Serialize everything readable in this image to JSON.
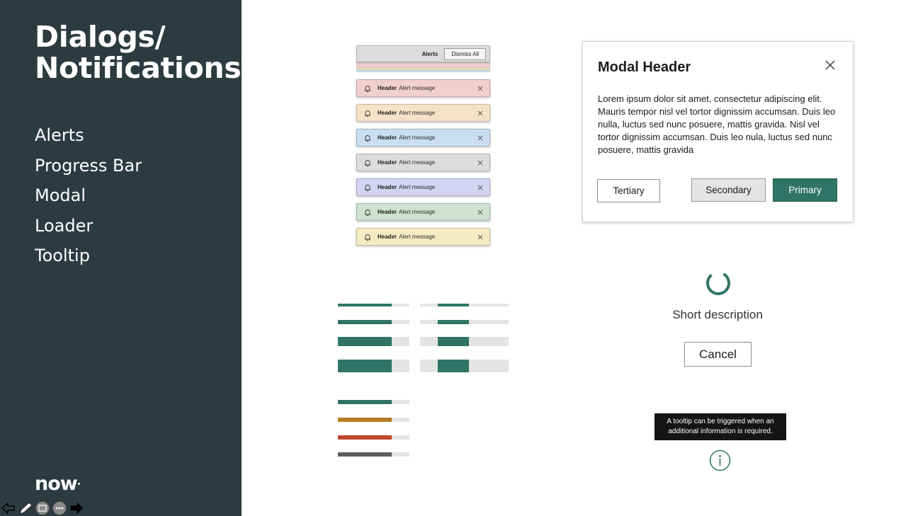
{
  "sidebar": {
    "title": "Dialogs/\nNotifications",
    "nav": [
      "Alerts",
      "Progress Bar",
      "Modal",
      "Loader",
      "Tooltip"
    ],
    "logo": "now"
  },
  "alerts": {
    "bar_label": "Alerts",
    "dismiss_label": "Dismiss All",
    "items": [
      {
        "header": "Header",
        "message": "Alert message",
        "color": "#efd0cd",
        "icon": "bell-icon"
      },
      {
        "header": "Header",
        "message": "Alert message",
        "color": "#f6e2c9",
        "icon": "bell-icon"
      },
      {
        "header": "Header",
        "message": "Alert message",
        "color": "#c9dff1",
        "icon": "bell-icon"
      },
      {
        "header": "Header",
        "message": "Alert message",
        "color": "#dcdcdc",
        "icon": "bell-icon"
      },
      {
        "header": "Header",
        "message": "Alert message",
        "color": "#d4d4f2",
        "icon": "bell-icon"
      },
      {
        "header": "Header",
        "message": "Alert message",
        "color": "#cde2cf",
        "icon": "bell-icon"
      },
      {
        "header": "Header",
        "message": "Alert message",
        "color": "#f4ebc3",
        "icon": "bell-icon"
      }
    ]
  },
  "modal": {
    "header": "Modal Header",
    "body": "Lorem ipsum dolor sit amet, consectetur adipiscing elit. Mauris tempor nisl vel tortor dignissim accumsan. Duis leo nulla, luctus sed nunc posuere, mattis gravida. Nisl vel tortor dignissim accumsan. Duis leo nula, luctus sed nunc posuere, mattis gravida",
    "tertiary_label": "Tertiary",
    "secondary_label": "Secondary",
    "primary_label": "Primary"
  },
  "progress": {
    "determinate_value": 0.75,
    "indeterminate": true,
    "status_values": [
      0.75,
      0.75,
      0.75,
      0.75
    ]
  },
  "loader": {
    "description": "Short description",
    "cancel_label": "Cancel"
  },
  "tooltip": {
    "line1": "A tooltip can be triggered when an",
    "line2": "additional information is required."
  },
  "colors": {
    "sidebar_bg": "#2c3b40",
    "brand_green": "#2f7464",
    "status_success": "#2f7464",
    "status_warning": "#b77c22",
    "status_error": "#c0462e",
    "status_neutral": "#5e5e5e"
  }
}
